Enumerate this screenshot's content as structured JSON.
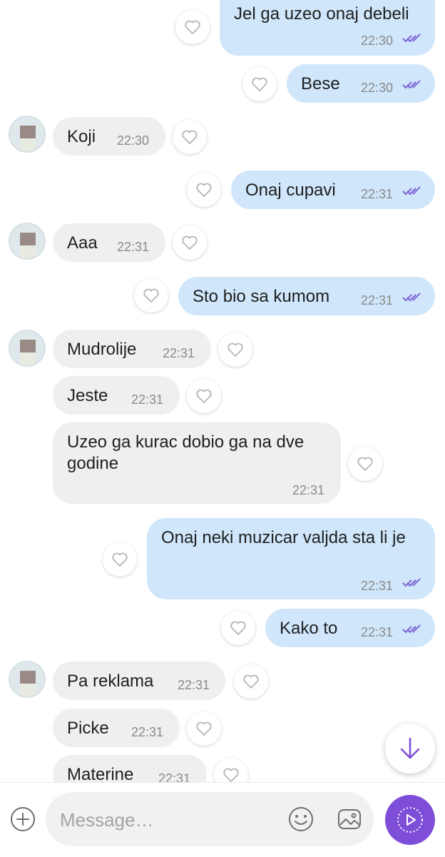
{
  "messages": [
    {
      "dir": "out",
      "text": "Jel ga uzeo onaj debeli",
      "time": "22:30"
    },
    {
      "dir": "out",
      "text": "Bese",
      "time": "22:30"
    },
    {
      "dir": "in",
      "text": "Koji",
      "time": "22:30"
    },
    {
      "dir": "out",
      "text": "Onaj cupavi",
      "time": "22:31"
    },
    {
      "dir": "in",
      "text": "Aaa",
      "time": "22:31"
    },
    {
      "dir": "out",
      "text": "Sto bio sa kumom",
      "time": "22:31"
    },
    {
      "dir": "in",
      "text": "Mudrolije",
      "time": "22:31"
    },
    {
      "dir": "in",
      "text": "Jeste",
      "time": "22:31"
    },
    {
      "dir": "in",
      "text": "Uzeo ga kurac dobio ga na dve godine",
      "time": "22:31"
    },
    {
      "dir": "out",
      "text": "Onaj neki muzicar valjda sta li je",
      "time": "22:31"
    },
    {
      "dir": "out",
      "text": "Kako to",
      "time": "22:31"
    },
    {
      "dir": "in",
      "text": "Pa reklama",
      "time": "22:31"
    },
    {
      "dir": "in",
      "text": "Picke",
      "time": "22:31"
    },
    {
      "dir": "in",
      "text": "Materine",
      "time": "22:31"
    }
  ],
  "composer": {
    "placeholder": "Message…"
  },
  "icons": {
    "like": "heart-outline-icon",
    "read": "double-check-icon",
    "scroll": "arrow-down-icon",
    "add": "plus-circle-icon",
    "emoji": "smiley-icon",
    "gallery": "image-icon",
    "send": "play-circle-icon"
  },
  "colors": {
    "incoming_bubble": "#efefef",
    "outgoing_bubble": "#cfe6fb",
    "accent": "#7f4ed9",
    "ticks": "#7f66d6"
  }
}
